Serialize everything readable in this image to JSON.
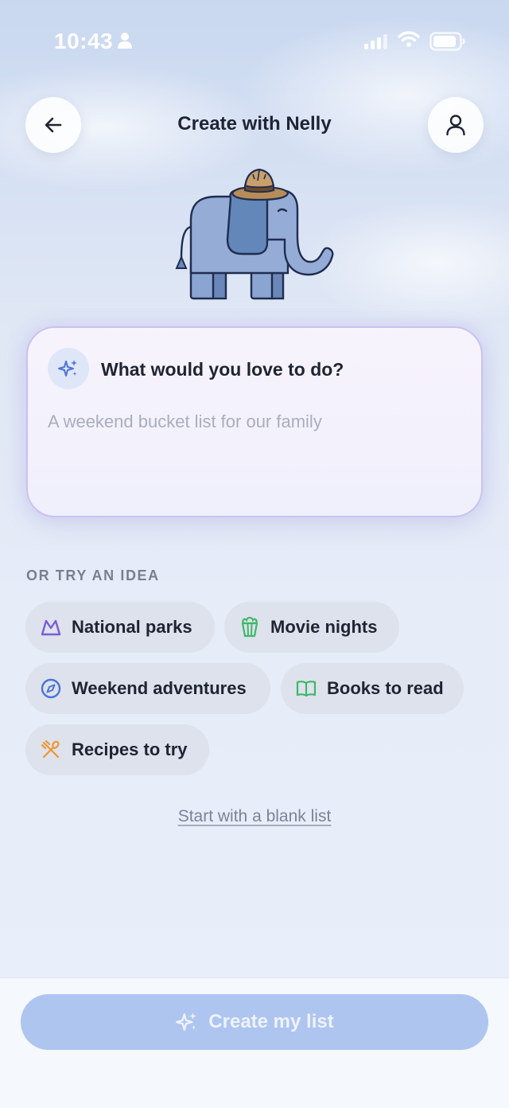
{
  "status_bar": {
    "time": "10:43",
    "icons": [
      "person-icon",
      "signal-icon",
      "wifi-icon",
      "battery-icon"
    ]
  },
  "header": {
    "title": "Create with Nelly",
    "back_icon": "arrow-left-icon",
    "profile_icon": "user-icon"
  },
  "mascot": {
    "icon": "elephant-with-hat-illustration"
  },
  "prompt": {
    "heading": "What would you love to do?",
    "placeholder": "A weekend bucket list for our family",
    "value": "",
    "icon": "sparkles-icon"
  },
  "ideas": {
    "label": "OR TRY AN IDEA",
    "chips": [
      {
        "label": "National parks",
        "icon": "mountain-icon",
        "color": "#7b5cd6"
      },
      {
        "label": "Movie nights",
        "icon": "popcorn-icon",
        "color": "#3fb76a"
      },
      {
        "label": "Weekend adventures",
        "icon": "compass-icon",
        "color": "#4a74d8"
      },
      {
        "label": "Books to read",
        "icon": "book-icon",
        "color": "#3fb76a"
      },
      {
        "label": "Recipes to try",
        "icon": "utensils-icon",
        "color": "#f0962e"
      }
    ]
  },
  "blank_link": "Start with a blank list",
  "create_button": {
    "label": "Create my list",
    "icon": "sparkles-icon"
  },
  "colors": {
    "accent_button": "#aec5ef",
    "chip_background": "#dde2ec",
    "title_text": "#1f2433"
  }
}
